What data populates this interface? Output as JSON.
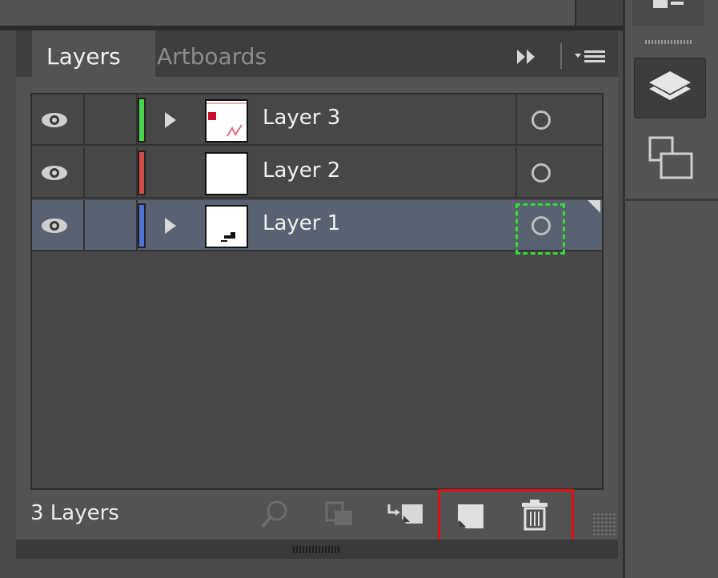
{
  "panel": {
    "tabs": [
      {
        "label": "Layers",
        "active": true
      },
      {
        "label": "Artboards",
        "active": false
      }
    ]
  },
  "layers": [
    {
      "name": "Layer 3",
      "color": "#4cd34c",
      "visible": true,
      "expandable": true,
      "selected": false
    },
    {
      "name": "Layer 2",
      "color": "#d34c4c",
      "visible": true,
      "expandable": false,
      "selected": false
    },
    {
      "name": "Layer 1",
      "color": "#4c72d3",
      "visible": true,
      "expandable": true,
      "selected": true
    }
  ],
  "footer": {
    "layer_count": "3 Layers"
  },
  "icons": {
    "flyout": "double-chevron-right-icon",
    "menu": "panel-menu-icon",
    "locate": "search-icon",
    "clip": "clipping-mask-icon",
    "sublayer": "new-sublayer-icon",
    "newlayer": "new-layer-icon",
    "delete": "trash-icon"
  },
  "colors": {
    "panel_bg": "#535353",
    "selected_row": "#5a6170",
    "highlight": "#e01010",
    "target_focus": "#33dd33"
  }
}
